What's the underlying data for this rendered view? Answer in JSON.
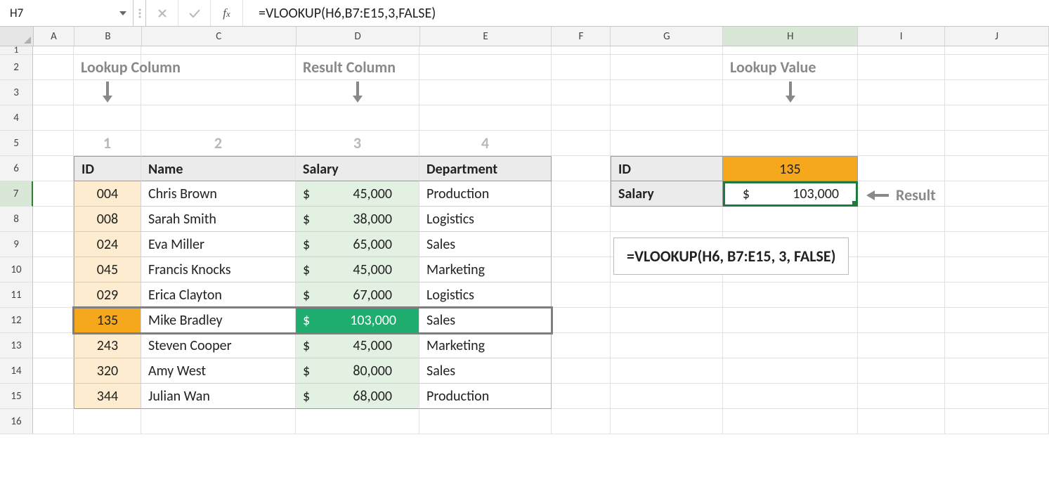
{
  "namebox": {
    "ref": "H7"
  },
  "formula_bar": {
    "formula": "=VLOOKUP(H6,B7:E15,3,FALSE)"
  },
  "columns": [
    "A",
    "B",
    "C",
    "D",
    "E",
    "F",
    "G",
    "H",
    "I",
    "J"
  ],
  "row_numbers": [
    "1",
    "2",
    "3",
    "4",
    "5",
    "6",
    "7",
    "8",
    "9",
    "10",
    "11",
    "12",
    "13",
    "14",
    "15",
    "16"
  ],
  "annotations": {
    "lookup_column": "Lookup Column",
    "result_column": "Result Column",
    "lookup_value": "Lookup Value",
    "result": "Result",
    "col_nums": {
      "c1": "1",
      "c2": "2",
      "c3": "3",
      "c4": "4"
    }
  },
  "table": {
    "headers": {
      "id": "ID",
      "name": "Name",
      "salary": "Salary",
      "dept": "Department"
    },
    "rows": [
      {
        "id": "004",
        "name": "Chris Brown",
        "salary": "45,000",
        "dept": "Production"
      },
      {
        "id": "008",
        "name": "Sarah Smith",
        "salary": "38,000",
        "dept": "Logistics"
      },
      {
        "id": "024",
        "name": "Eva Miller",
        "salary": "65,000",
        "dept": "Sales"
      },
      {
        "id": "045",
        "name": "Francis Knocks",
        "salary": "45,000",
        "dept": "Marketing"
      },
      {
        "id": "029",
        "name": "Erica Clayton",
        "salary": "67,000",
        "dept": "Logistics"
      },
      {
        "id": "135",
        "name": "Mike Bradley",
        "salary": "103,000",
        "dept": "Sales"
      },
      {
        "id": "243",
        "name": "Steven Cooper",
        "salary": "45,000",
        "dept": "Marketing"
      },
      {
        "id": "320",
        "name": "Amy West",
        "salary": "80,000",
        "dept": "Sales"
      },
      {
        "id": "344",
        "name": "Julian Wan",
        "salary": "68,000",
        "dept": "Production"
      }
    ],
    "currency": "$"
  },
  "lookup_box": {
    "id_label": "ID",
    "id_value": "135",
    "salary_label": "Salary",
    "salary_cur": "$",
    "salary_value": "103,000"
  },
  "formula_display": "=VLOOKUP(H6, B7:E15, 3, FALSE)"
}
